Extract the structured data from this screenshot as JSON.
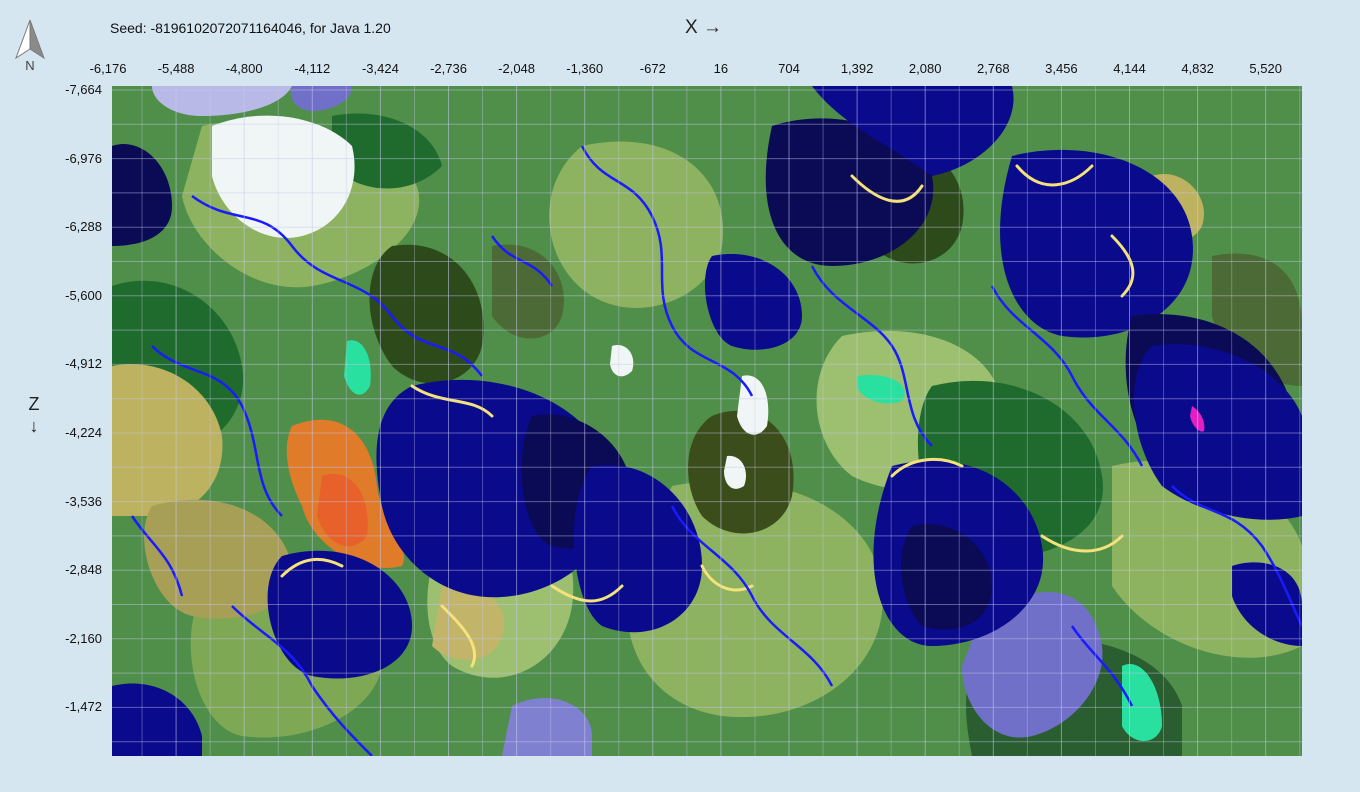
{
  "header": {
    "seed_label": "Seed: -8196102072071164046, for Java 1.20",
    "x_axis_label": "X →",
    "z_axis_label": "Z",
    "z_arrow": "↓",
    "compass_letter": "N"
  },
  "icons": {
    "compass": "north-arrow-icon"
  },
  "axes": {
    "x_ticks": [
      "-6,176",
      "-5,488",
      "-4,800",
      "-4,112",
      "-3,424",
      "-2,736",
      "-2,048",
      "-1,360",
      "-672",
      "16",
      "704",
      "1,392",
      "2,080",
      "2,768",
      "3,456",
      "4,144",
      "4,832",
      "5,520"
    ],
    "z_ticks": [
      "-7,664",
      "-6,976",
      "-6,288",
      "-5,600",
      "-4,912",
      "-4,224",
      "-3,536",
      "-2,848",
      "-2,160",
      "-1,472"
    ]
  },
  "colors": {
    "background": "#d6e6f1",
    "deep_ocean": "#0b0b55",
    "ocean": "#0a0a8c",
    "river": "#1a1aff",
    "forest": "#1f6b2e",
    "dark_forest": "#2c4a1a",
    "plains": "#8db360",
    "birch_forest": "#4f8f4a",
    "savanna": "#bdb25f",
    "badlands": "#e07b2a",
    "snowy": "#f0f5f5",
    "beach": "#f5e27a",
    "swamp": "#4c6a35",
    "ice": "#7070c8",
    "jungle": "#2ae0a0"
  }
}
